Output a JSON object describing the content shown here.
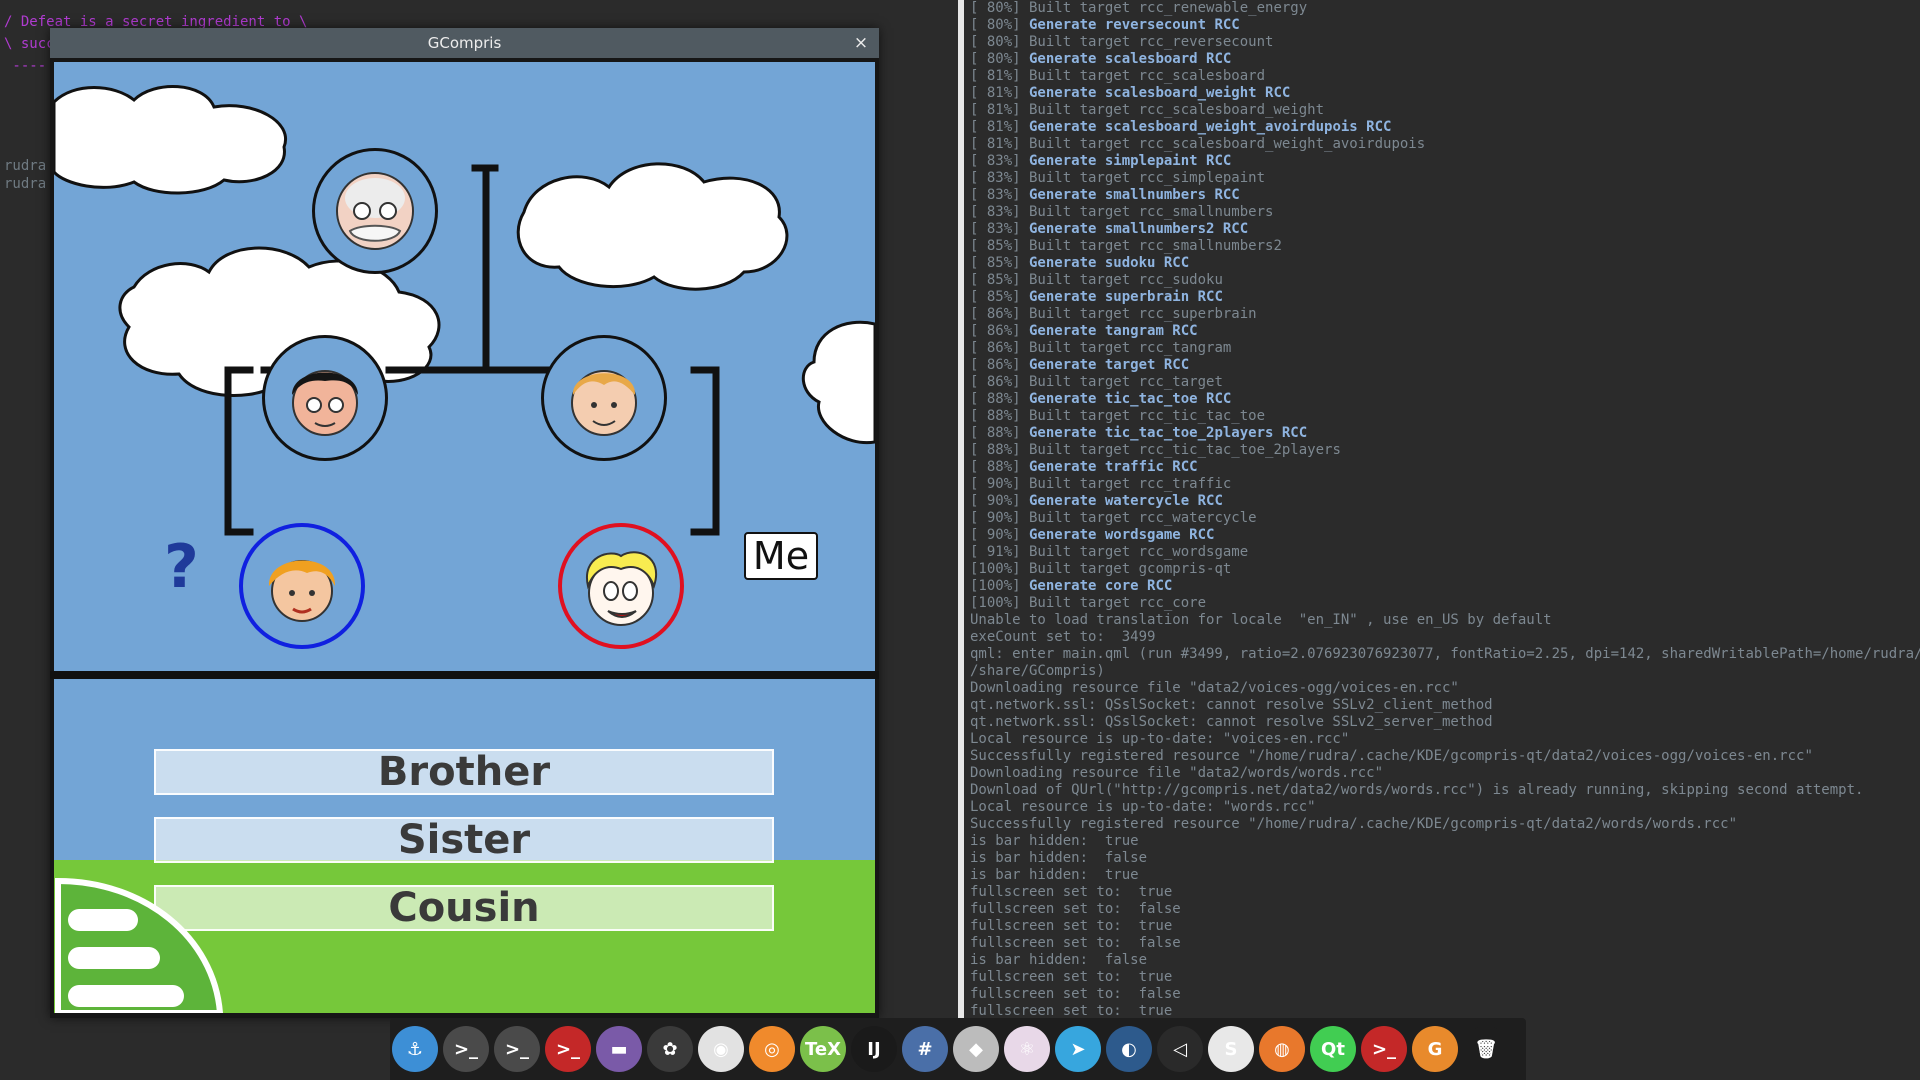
{
  "background_terminal": {
    "lines": [
      "/ Defeat is a secret ingredient to \\",
      "\\ succ",
      " ----",
      "rudra",
      "rudra"
    ]
  },
  "window": {
    "title": "GCompris",
    "close_glyph": "×"
  },
  "game": {
    "question_mark": "?",
    "me_label": "Me",
    "answers": [
      "Brother",
      "Sister",
      "Cousin"
    ]
  },
  "terminal": {
    "lines": [
      {
        "pct": "[ 80%]",
        "text": " Built target rcc_renewable_energy",
        "gen": false
      },
      {
        "pct": "[ 80%]",
        "text": " Generate reversecount RCC",
        "gen": true
      },
      {
        "pct": "[ 80%]",
        "text": " Built target rcc_reversecount",
        "gen": false
      },
      {
        "pct": "[ 80%]",
        "text": " Generate scalesboard RCC",
        "gen": true
      },
      {
        "pct": "[ 81%]",
        "text": " Built target rcc_scalesboard",
        "gen": false
      },
      {
        "pct": "[ 81%]",
        "text": " Generate scalesboard_weight RCC",
        "gen": true
      },
      {
        "pct": "[ 81%]",
        "text": " Built target rcc_scalesboard_weight",
        "gen": false
      },
      {
        "pct": "[ 81%]",
        "text": " Generate scalesboard_weight_avoirdupois RCC",
        "gen": true
      },
      {
        "pct": "[ 81%]",
        "text": " Built target rcc_scalesboard_weight_avoirdupois",
        "gen": false
      },
      {
        "pct": "[ 83%]",
        "text": " Generate simplepaint RCC",
        "gen": true
      },
      {
        "pct": "[ 83%]",
        "text": " Built target rcc_simplepaint",
        "gen": false
      },
      {
        "pct": "[ 83%]",
        "text": " Generate smallnumbers RCC",
        "gen": true
      },
      {
        "pct": "[ 83%]",
        "text": " Built target rcc_smallnumbers",
        "gen": false
      },
      {
        "pct": "[ 83%]",
        "text": " Generate smallnumbers2 RCC",
        "gen": true
      },
      {
        "pct": "[ 85%]",
        "text": " Built target rcc_smallnumbers2",
        "gen": false
      },
      {
        "pct": "[ 85%]",
        "text": " Generate sudoku RCC",
        "gen": true
      },
      {
        "pct": "[ 85%]",
        "text": " Built target rcc_sudoku",
        "gen": false
      },
      {
        "pct": "[ 85%]",
        "text": " Generate superbrain RCC",
        "gen": true
      },
      {
        "pct": "[ 86%]",
        "text": " Built target rcc_superbrain",
        "gen": false
      },
      {
        "pct": "[ 86%]",
        "text": " Generate tangram RCC",
        "gen": true
      },
      {
        "pct": "[ 86%]",
        "text": " Built target rcc_tangram",
        "gen": false
      },
      {
        "pct": "[ 86%]",
        "text": " Generate target RCC",
        "gen": true
      },
      {
        "pct": "[ 86%]",
        "text": " Built target rcc_target",
        "gen": false
      },
      {
        "pct": "[ 88%]",
        "text": " Generate tic_tac_toe RCC",
        "gen": true
      },
      {
        "pct": "[ 88%]",
        "text": " Built target rcc_tic_tac_toe",
        "gen": false
      },
      {
        "pct": "[ 88%]",
        "text": " Generate tic_tac_toe_2players RCC",
        "gen": true
      },
      {
        "pct": "[ 88%]",
        "text": " Built target rcc_tic_tac_toe_2players",
        "gen": false
      },
      {
        "pct": "[ 88%]",
        "text": " Generate traffic RCC",
        "gen": true
      },
      {
        "pct": "[ 90%]",
        "text": " Built target rcc_traffic",
        "gen": false
      },
      {
        "pct": "[ 90%]",
        "text": " Generate watercycle RCC",
        "gen": true
      },
      {
        "pct": "[ 90%]",
        "text": " Built target rcc_watercycle",
        "gen": false
      },
      {
        "pct": "[ 90%]",
        "text": " Generate wordsgame RCC",
        "gen": true
      },
      {
        "pct": "[ 91%]",
        "text": " Built target rcc_wordsgame",
        "gen": false
      },
      {
        "pct": "[100%]",
        "text": " Built target gcompris-qt",
        "gen": false
      },
      {
        "pct": "[100%]",
        "text": " Generate core RCC",
        "gen": true
      },
      {
        "pct": "[100%]",
        "text": " Built target rcc_core",
        "gen": false
      },
      {
        "pct": "",
        "text": "Unable to load translation for locale  \"en_IN\" , use en_US by default",
        "gen": false
      },
      {
        "pct": "",
        "text": "exeCount set to:  3499",
        "gen": false
      },
      {
        "pct": "",
        "text": "qml: enter main.qml (run #3499, ratio=2.076923076923077, fontRatio=2.25, dpi=142, sharedWritablePath=/home/rudra/.local",
        "gen": false
      },
      {
        "pct": "",
        "text": "/share/GCompris)",
        "gen": false
      },
      {
        "pct": "",
        "text": "Downloading resource file \"data2/voices-ogg/voices-en.rcc\"",
        "gen": false
      },
      {
        "pct": "",
        "text": "qt.network.ssl: QSslSocket: cannot resolve SSLv2_client_method",
        "gen": false
      },
      {
        "pct": "",
        "text": "qt.network.ssl: QSslSocket: cannot resolve SSLv2_server_method",
        "gen": false
      },
      {
        "pct": "",
        "text": "Local resource is up-to-date: \"voices-en.rcc\"",
        "gen": false
      },
      {
        "pct": "",
        "text": "Successfully registered resource \"/home/rudra/.cache/KDE/gcompris-qt/data2/voices-ogg/voices-en.rcc\"",
        "gen": false
      },
      {
        "pct": "",
        "text": "Downloading resource file \"data2/words/words.rcc\"",
        "gen": false
      },
      {
        "pct": "",
        "text": "Download of QUrl(\"http://gcompris.net/data2/words/words.rcc\") is already running, skipping second attempt.",
        "gen": false
      },
      {
        "pct": "",
        "text": "Local resource is up-to-date: \"words.rcc\"",
        "gen": false
      },
      {
        "pct": "",
        "text": "Successfully registered resource \"/home/rudra/.cache/KDE/gcompris-qt/data2/words/words.rcc\"",
        "gen": false
      },
      {
        "pct": "",
        "text": "is bar hidden:  true",
        "gen": false
      },
      {
        "pct": "",
        "text": "is bar hidden:  false",
        "gen": false
      },
      {
        "pct": "",
        "text": "is bar hidden:  true",
        "gen": false
      },
      {
        "pct": "",
        "text": "fullscreen set to:  true",
        "gen": false
      },
      {
        "pct": "",
        "text": "fullscreen set to:  false",
        "gen": false
      },
      {
        "pct": "",
        "text": "fullscreen set to:  true",
        "gen": false
      },
      {
        "pct": "",
        "text": "fullscreen set to:  false",
        "gen": false
      },
      {
        "pct": "",
        "text": "is bar hidden:  false",
        "gen": false
      },
      {
        "pct": "",
        "text": "fullscreen set to:  true",
        "gen": false
      },
      {
        "pct": "",
        "text": "fullscreen set to:  false",
        "gen": false
      },
      {
        "pct": "",
        "text": "fullscreen set to:  true",
        "gen": false
      }
    ]
  },
  "dock": {
    "items": [
      {
        "name": "anchor-icon",
        "glyph": "⚓",
        "bg": "#3d8fd6"
      },
      {
        "name": "terminal-icon",
        "glyph": ">_",
        "bg": "#4a4a4a"
      },
      {
        "name": "terminal2-icon",
        "glyph": ">_",
        "bg": "#4a4a4a"
      },
      {
        "name": "terminal-red-icon",
        "glyph": ">_",
        "bg": "#c42828"
      },
      {
        "name": "files-icon",
        "glyph": "▬",
        "bg": "#7a5aa8"
      },
      {
        "name": "settings-icon",
        "glyph": "✿",
        "bg": "#3a3a3a"
      },
      {
        "name": "chrome-icon",
        "glyph": "◉",
        "bg": "#e2e2e2"
      },
      {
        "name": "screenshot-icon",
        "glyph": "◎",
        "bg": "#f08a2c"
      },
      {
        "name": "tex-icon",
        "glyph": "TeX",
        "bg": "#7bc04a"
      },
      {
        "name": "intellij-icon",
        "glyph": "IJ",
        "bg": "#1a1a1a"
      },
      {
        "name": "hashtag-icon",
        "glyph": "#",
        "bg": "#4a6fa8"
      },
      {
        "name": "stack-icon",
        "glyph": "◆",
        "bg": "#bcbcbc"
      },
      {
        "name": "atom-icon",
        "glyph": "⚛",
        "bg": "#e8d8e8"
      },
      {
        "name": "telegram-icon",
        "glyph": "➤",
        "bg": "#37a6de"
      },
      {
        "name": "blender-icon",
        "glyph": "◐",
        "bg": "#2d5a8c"
      },
      {
        "name": "vscode-icon",
        "glyph": "◁",
        "bg": "#2a2a2a"
      },
      {
        "name": "sublime-icon",
        "glyph": "S",
        "bg": "#e8e8e8"
      },
      {
        "name": "firefox-icon",
        "glyph": "◍",
        "bg": "#e8782c"
      },
      {
        "name": "qt-icon",
        "glyph": "Qt",
        "bg": "#41cd52"
      },
      {
        "name": "terminal-red2-icon",
        "glyph": ">_",
        "bg": "#c42828"
      },
      {
        "name": "gcompris-icon",
        "glyph": "G",
        "bg": "#e88a2c"
      },
      {
        "name": "trash-icon",
        "glyph": "🗑",
        "bg": "#1e1e1e"
      }
    ]
  }
}
